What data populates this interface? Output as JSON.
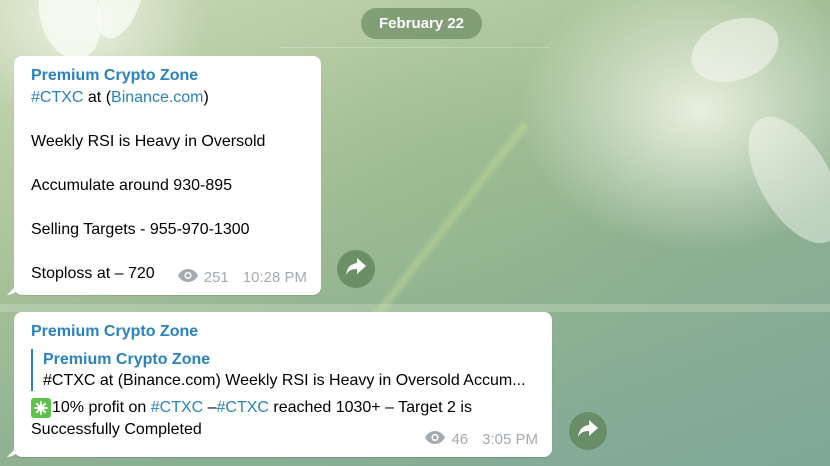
{
  "date_separator": "February 22",
  "messages": [
    {
      "sender": "Premium Crypto Zone",
      "line1_tag": "#CTXC",
      "line1_at": " at (",
      "line1_link": "Binance.com",
      "line1_close": ")",
      "line2": "Weekly RSI is Heavy in Oversold",
      "line3": "Accumulate around 930-895",
      "line4": "Selling Targets - 955-970-1300",
      "line5": "Stoploss at – 720",
      "views": "251",
      "time": "10:28 PM"
    },
    {
      "sender": "Premium Crypto Zone",
      "reply_sender": "Premium Crypto Zone",
      "reply_text": "#CTXC at (Binance.com)  Weekly RSI is Heavy in Oversold  Accum...",
      "text_pre": "10% profit on ",
      "tag1": "#CTXC",
      "text_mid": " –",
      "tag2": "#CTXC",
      "text_post": " reached 1030+ – Target 2 is",
      "text_line2": "Successfully Completed",
      "views": "46",
      "time": "3:05 PM"
    }
  ],
  "icons": {
    "views": "eye-icon",
    "share": "share-arrow-icon",
    "check": "check-mark-emoji-icon"
  },
  "colors": {
    "link": "#2b82c0",
    "meta": "#a5abb1",
    "check_emoji": "#5cc24b"
  }
}
